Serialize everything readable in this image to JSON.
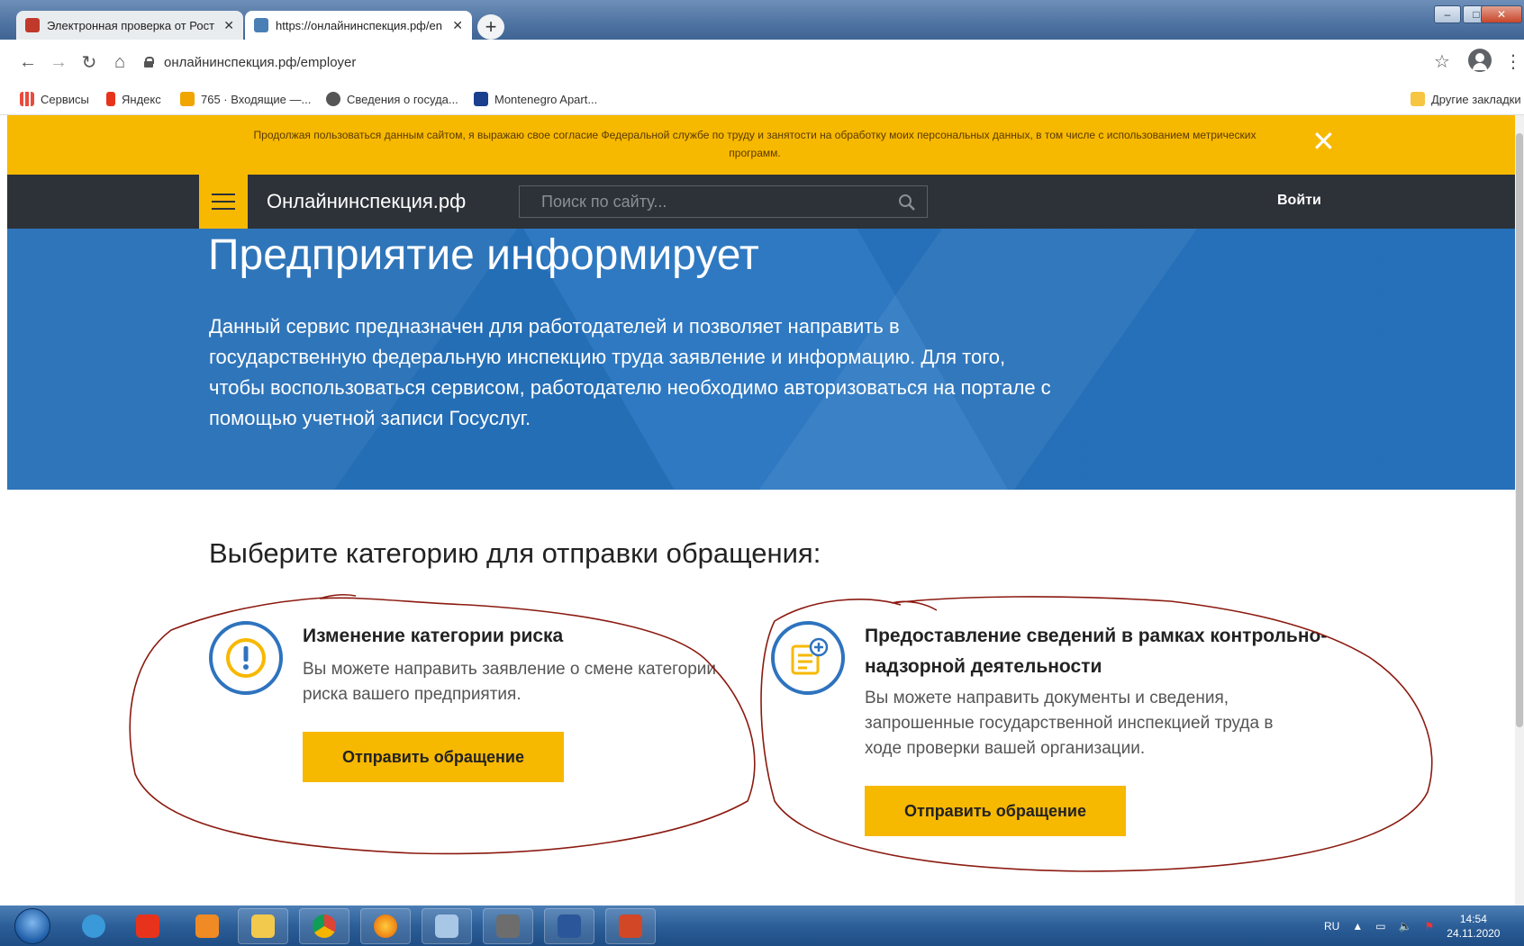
{
  "browser": {
    "tabs": [
      {
        "title": "Электронная проверка от Рост",
        "favicon_color": "#c0392b",
        "active": false
      },
      {
        "title": "https://онлайнинспекция.рф/en",
        "favicon_color": "#4a7fb5",
        "active": true
      }
    ],
    "new_tab_label": "+",
    "url": "онлайнинспекция.рф/employer",
    "bookmarks": [
      {
        "label": "Сервисы",
        "icon_color": "#e84c3d"
      },
      {
        "label": "Яндекс",
        "icon_color": "#e8331c"
      },
      {
        "label": "765 · Входящие —...",
        "icon_color": "#f0a500"
      },
      {
        "label": "Сведения о госуда...",
        "icon_color": "#555555"
      },
      {
        "label": "Montenegro Apart...",
        "icon_color": "#1a3f8f"
      }
    ],
    "other_bookmarks": "Другие закладки"
  },
  "cookie_banner": {
    "text": "Продолжая пользоваться данным сайтом, я выражаю свое согласие Федеральной службе по труду и занятости на обработку моих персональных данных, в том числе с использованием метрических программ.",
    "close_glyph": "✕"
  },
  "header": {
    "logo": "Онлайнинспекция.рф",
    "search_placeholder": "Поиск по сайту...",
    "login": "Войти"
  },
  "hero": {
    "title": "Предприятие информирует",
    "description": "Данный сервис предназначен для работодателей и позволяет направить в государственную федеральную инспекцию труда заявление и информацию. Для того, чтобы воспользоваться сервисом, работодателю необходимо авторизоваться на портале с помощью учетной записи Госуслуг."
  },
  "categories": {
    "heading": "Выберите категорию для отправки обращения:",
    "items": [
      {
        "title": "Изменение категории риска",
        "description": "Вы можете направить заявление о смене категории риска вашего предприятия.",
        "button": "Отправить обращение",
        "icon": "exclamation-circle-icon"
      },
      {
        "title": "Предоставление сведений в рамках контрольно-надзорной деятельности",
        "description": "Вы можете направить документы и сведения, запрошенные государственной инспекцией труда в ходе проверки вашей организации.",
        "button": "Отправить обращение",
        "icon": "document-plus-icon"
      }
    ]
  },
  "colors": {
    "accent_yellow": "#f7b800",
    "header_dark": "#2d3138",
    "hero_blue": "#2674c0",
    "icon_blue": "#2e73be",
    "annotation_red": "#8b1a10"
  },
  "taskbar": {
    "language": "RU",
    "time": "14:54",
    "date": "24.11.2020"
  }
}
